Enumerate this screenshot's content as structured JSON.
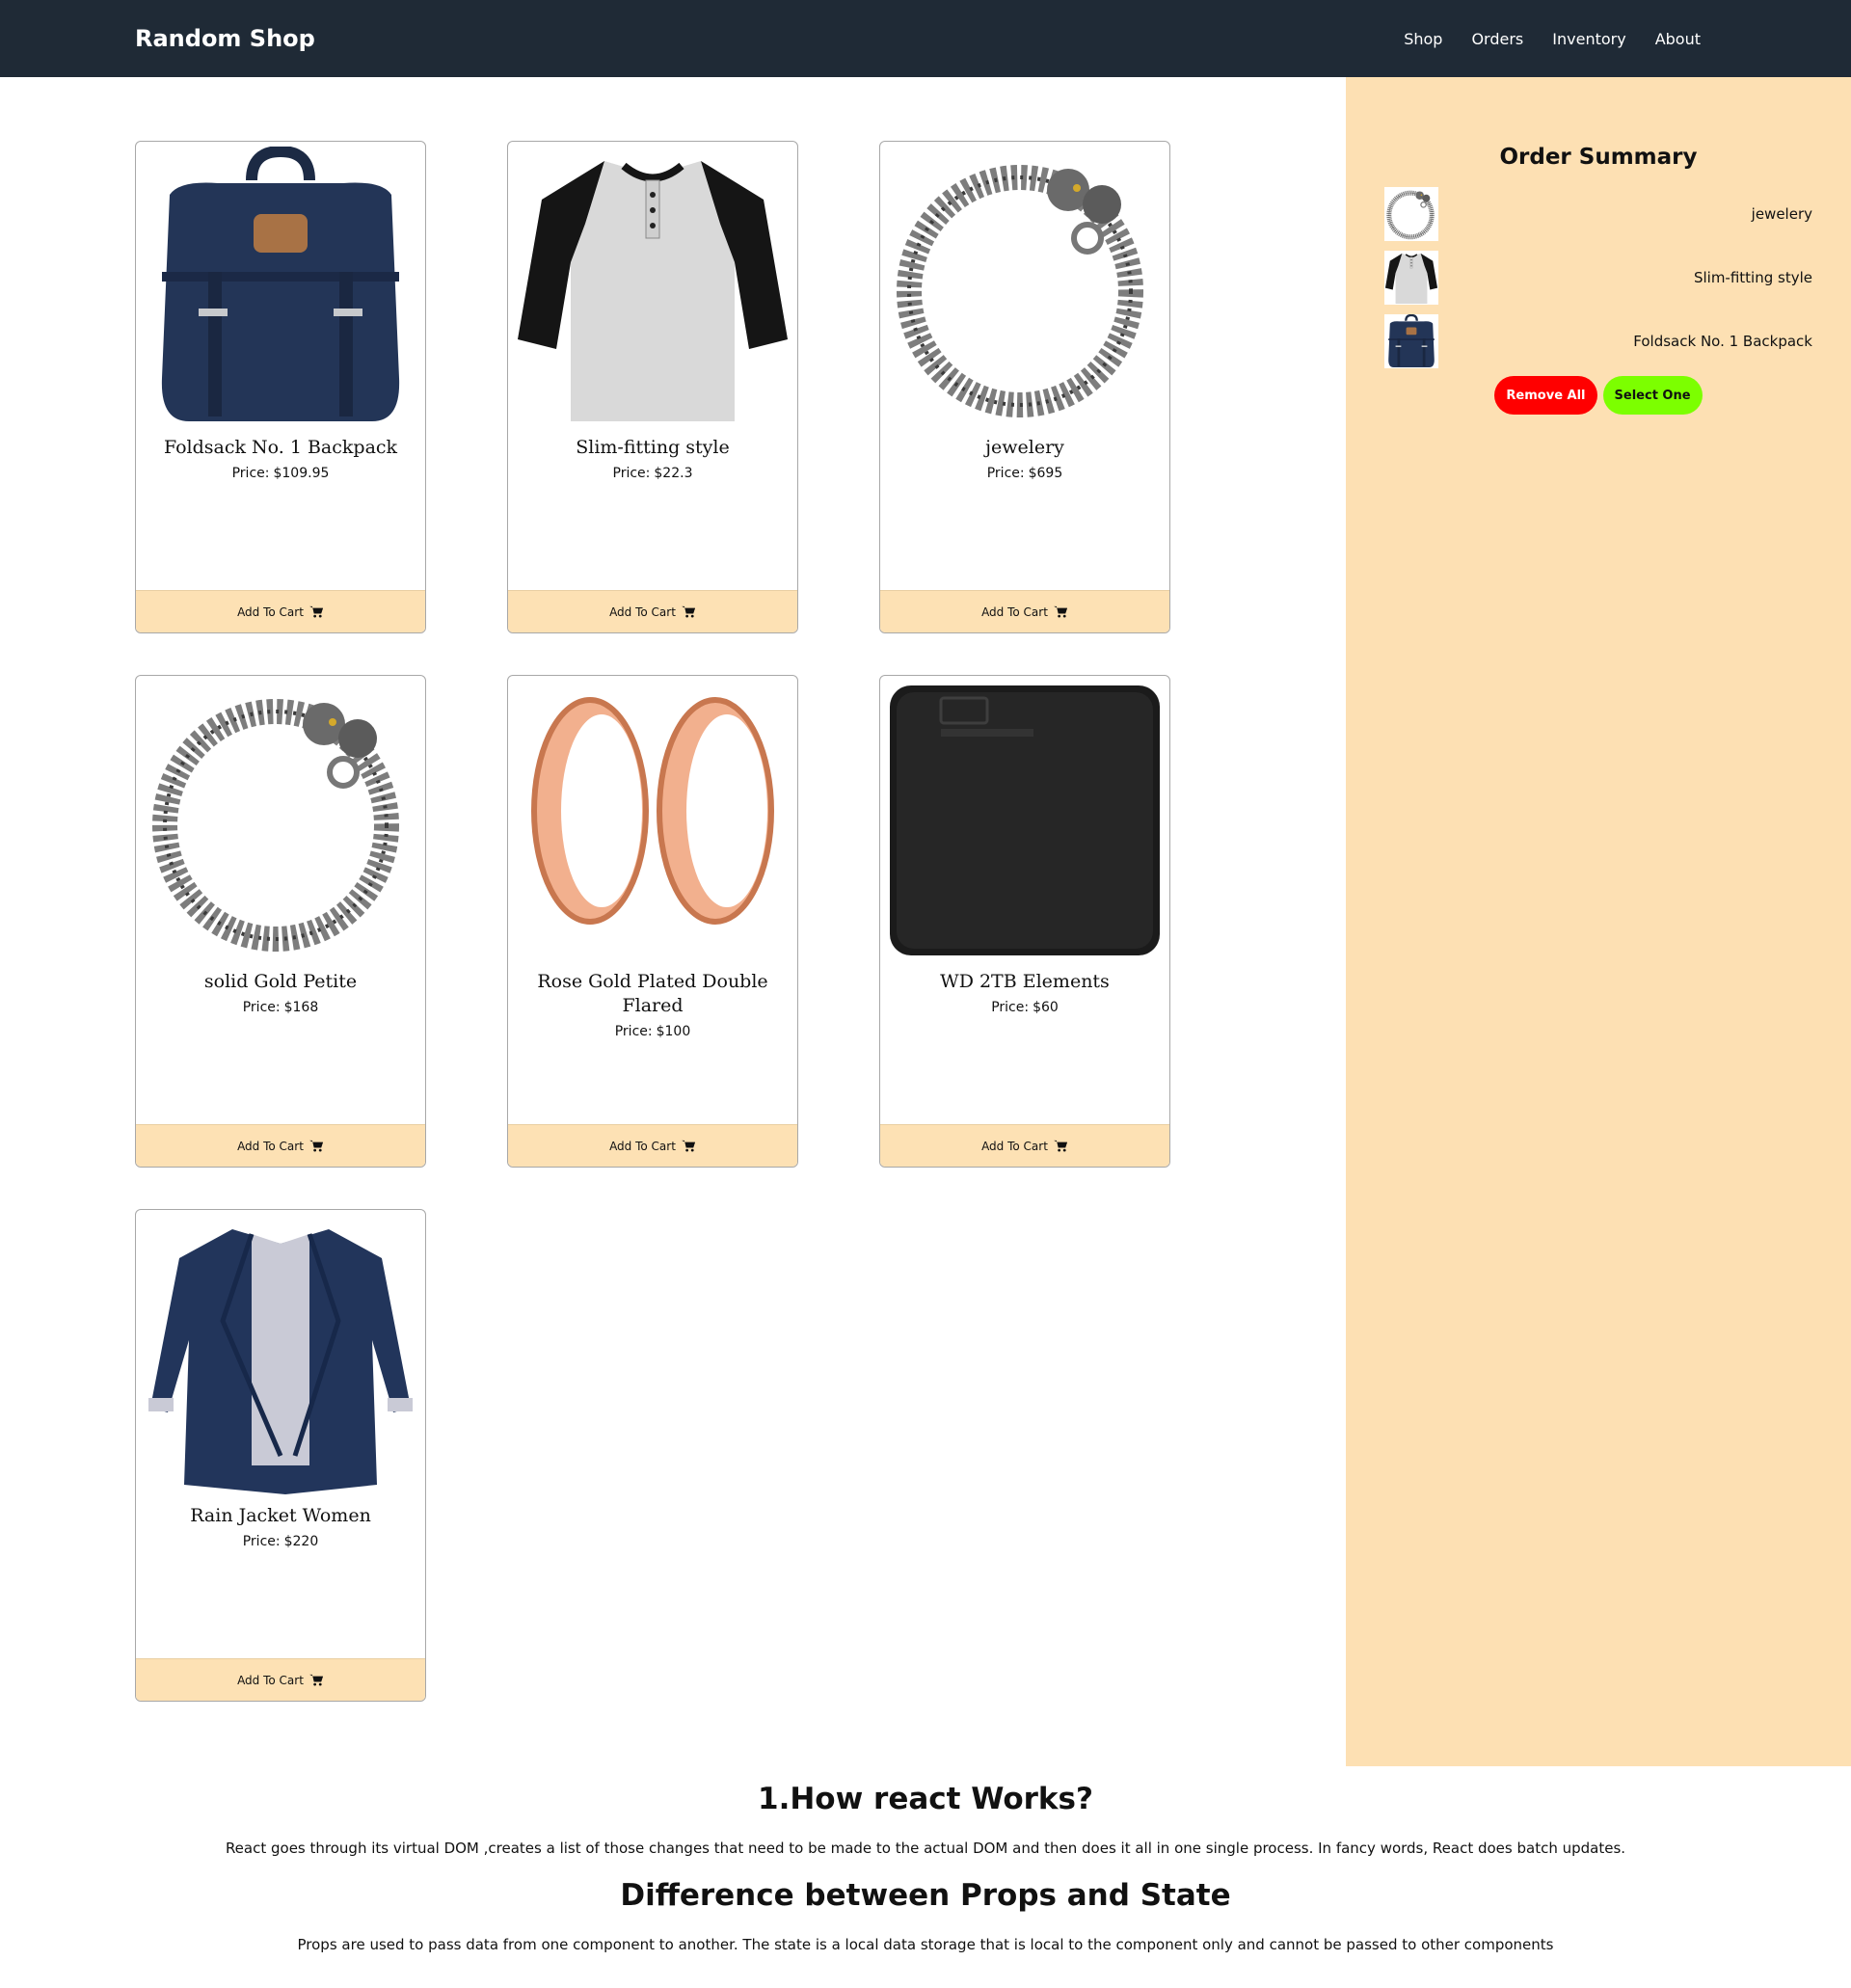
{
  "nav": {
    "brand": "Random Shop",
    "links": [
      "Shop",
      "Orders",
      "Inventory",
      "About"
    ]
  },
  "cart_button_label": "Add To Cart",
  "price_prefix": "Price:",
  "products": [
    {
      "name": "Foldsack No. 1 Backpack",
      "price": "$109.95",
      "icon": "backpack-image"
    },
    {
      "name": "Slim-fitting style",
      "price": "$22.3",
      "icon": "tshirt-image"
    },
    {
      "name": "jewelery",
      "price": "$695",
      "icon": "bracelet-image"
    },
    {
      "name": "solid Gold Petite",
      "price": "$168",
      "icon": "bracelet-image"
    },
    {
      "name": "Rose Gold Plated Double Flared",
      "price": "$100",
      "icon": "rings-image"
    },
    {
      "name": "WD 2TB Elements",
      "price": "$60",
      "icon": "hard-drive-image"
    },
    {
      "name": "Rain Jacket Women",
      "price": "$220",
      "icon": "jacket-image"
    }
  ],
  "summary": {
    "title": "Order Summary",
    "items": [
      {
        "name": "jewelery",
        "icon": "bracelet-image"
      },
      {
        "name": "Slim-fitting style",
        "icon": "tshirt-image"
      },
      {
        "name": "Foldsack No. 1 Backpack",
        "icon": "backpack-image"
      }
    ],
    "remove_all_label": "Remove All",
    "select_one_label": "Select One"
  },
  "faq": [
    {
      "title": "1.How react Works?",
      "text": "React goes through its virtual DOM ,creates a list of those changes that need to be made to the actual DOM and then does it all in one single process. In fancy words, React does batch updates."
    },
    {
      "title": "Difference between Props and State",
      "text": "Props are used to pass data from one component to another. The state is a local data storage that is local to the component only and cannot be passed to other components"
    }
  ],
  "colors": {
    "navbar": "#1f2a36",
    "sidebar": "#fde0b3",
    "cart_button": "#fde1b4",
    "remove_button": "#ff0000",
    "select_button": "#7cff00"
  }
}
